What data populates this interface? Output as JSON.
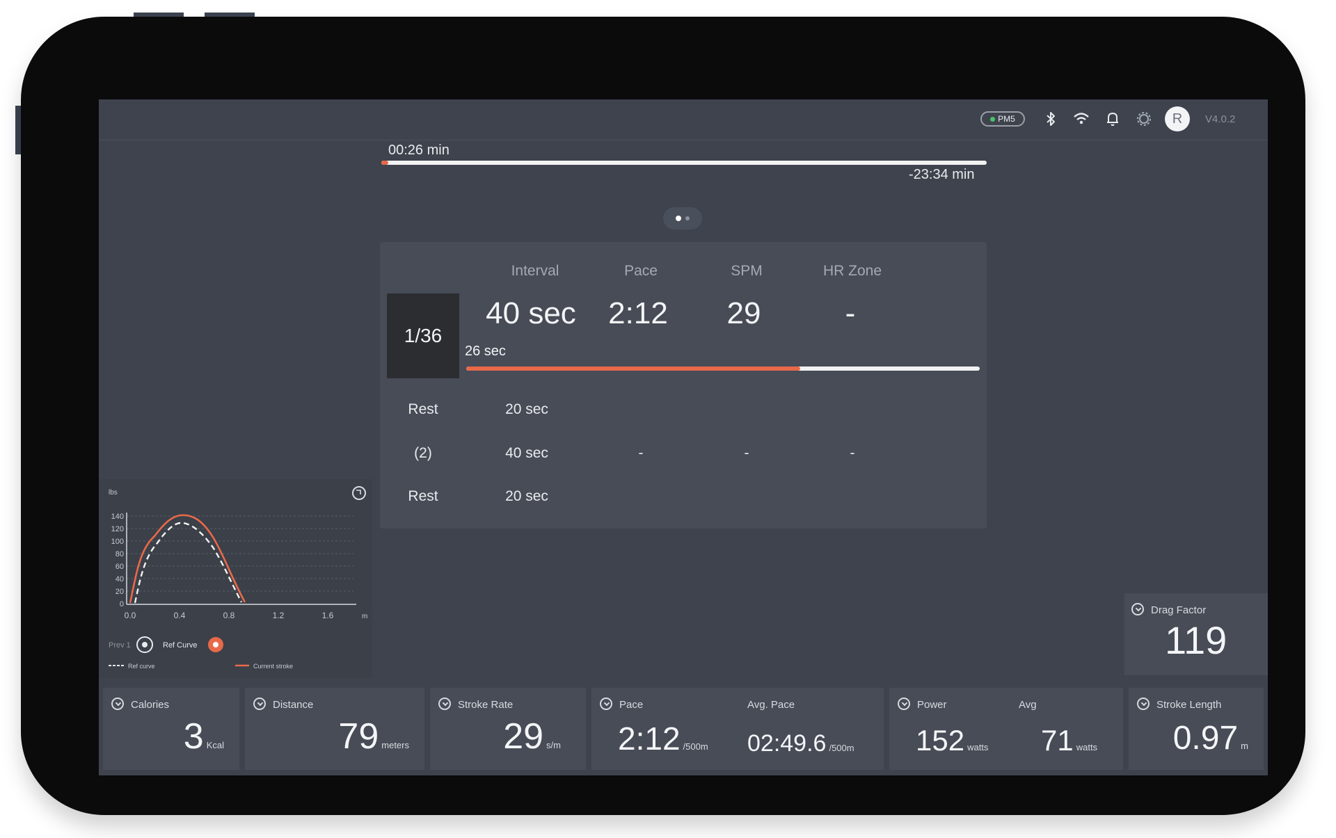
{
  "status_bar": {
    "pm_label": "PM5",
    "avatar_initial": "R",
    "version": "V4.0.2"
  },
  "session": {
    "elapsed": "00:26 min",
    "remaining": "-23:34 min",
    "progress_fraction": 0.012
  },
  "intervals": {
    "headers": [
      "Interval",
      "Pace",
      "SPM",
      "HR Zone"
    ],
    "counter": "1/36",
    "current": {
      "interval": "40 sec",
      "pace": "2:12",
      "spm": "29",
      "hr_zone": "-",
      "elapsed": "26 sec",
      "progress_fraction": 0.65
    },
    "upcoming": [
      {
        "label": "Rest",
        "interval": "20 sec",
        "pace": "",
        "spm": "",
        "hr_zone": ""
      },
      {
        "label": "(2)",
        "interval": "40 sec",
        "pace": "-",
        "spm": "-",
        "hr_zone": "-"
      },
      {
        "label": "Rest",
        "interval": "20 sec",
        "pace": "",
        "spm": "",
        "hr_zone": ""
      }
    ]
  },
  "force_curve": {
    "y_unit": "lbs",
    "x_unit": "m",
    "y_ticks": [
      "140",
      "120",
      "100",
      "80",
      "60",
      "40",
      "20",
      "0"
    ],
    "x_ticks": [
      "0.0",
      "0.4",
      "0.8",
      "1.2",
      "1.6"
    ],
    "toggle_prev_label": "Prev 1",
    "toggle_ref_label": "Ref Curve",
    "legend_ref": "Ref curve",
    "legend_current": "Current stroke"
  },
  "drag_factor": {
    "label": "Drag Factor",
    "value": "119"
  },
  "stats": {
    "calories": {
      "label": "Calories",
      "value": "3",
      "unit": "Kcal"
    },
    "distance": {
      "label": "Distance",
      "value": "79",
      "unit": "meters"
    },
    "stroke_rate": {
      "label": "Stroke Rate",
      "value": "29",
      "unit": "s/m"
    },
    "pace": {
      "label": "Pace",
      "value": "2:12",
      "unit": "/500m",
      "avg_label": "Avg. Pace",
      "avg_value": "02:49.6",
      "avg_unit": "/500m"
    },
    "power": {
      "label": "Power",
      "value": "152",
      "unit": "watts",
      "avg_label": "Avg",
      "avg_value": "71",
      "avg_unit": "watts"
    },
    "stroke_length": {
      "label": "Stroke Length",
      "value": "0.97",
      "unit": "m"
    }
  },
  "colors": {
    "accent": "#e8694a",
    "panel": "#474c57",
    "screen": "#3e434d"
  }
}
